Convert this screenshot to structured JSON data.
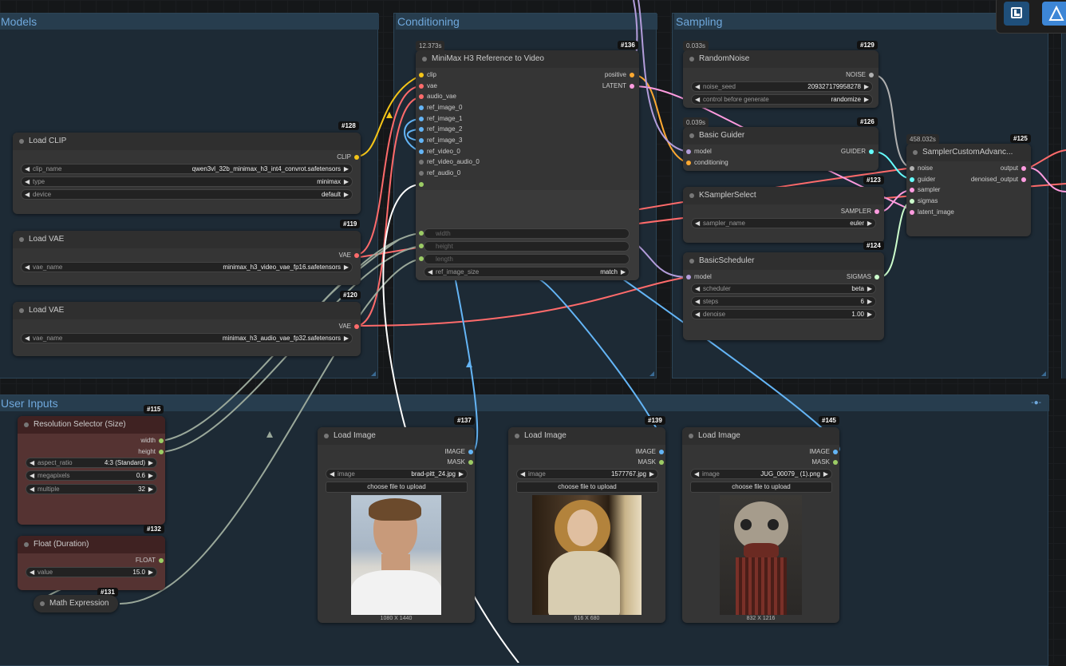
{
  "groups": {
    "models": "Models",
    "conditioning": "Conditioning",
    "sampling": "Sampling",
    "user_inputs": "User Inputs"
  },
  "nodes": {
    "load_clip": {
      "title": "Load CLIP",
      "id": "#128",
      "output": "CLIP",
      "clip_name_label": "clip_name",
      "clip_name": "qwen3vl_32b_minimax_h3_int4_convrot.safetensors",
      "type_label": "type",
      "type": "minimax",
      "device_label": "device",
      "device": "default"
    },
    "load_vae_video": {
      "title": "Load VAE",
      "id": "#119",
      "output": "VAE",
      "vae_name_label": "vae_name",
      "vae_name": "minimax_h3_video_vae_fp16.safetensors"
    },
    "load_vae_audio": {
      "title": "Load VAE",
      "id": "#120",
      "output": "VAE",
      "vae_name_label": "vae_name",
      "vae_name": "minimax_h3_audio_vae_fp32.safetensors"
    },
    "minimax": {
      "title": "MiniMax H3 Reference to Video",
      "id": "#136",
      "time": "12.373s",
      "inputs": [
        "clip",
        "vae",
        "audio_vae",
        "ref_image_0",
        "ref_image_1",
        "ref_image_2",
        "ref_image_3",
        "ref_video_0",
        "ref_video_audio_0",
        "ref_audio_0"
      ],
      "outputs": [
        "positive",
        "LATENT"
      ],
      "width_label": "width",
      "height_label": "height",
      "length_label": "length",
      "ref_image_size_label": "ref_image_size",
      "ref_image_size": "match"
    },
    "random_noise": {
      "title": "RandomNoise",
      "id": "#129",
      "time": "0.033s",
      "output": "NOISE",
      "noise_seed_label": "noise_seed",
      "noise_seed": "209327179958278",
      "control_label": "control before generate",
      "control": "randomize"
    },
    "basic_guider": {
      "title": "Basic Guider",
      "id": "#126",
      "time": "0.039s",
      "output": "GUIDER",
      "inputs": [
        "model",
        "conditioning"
      ]
    },
    "ksampler_select": {
      "title": "KSamplerSelect",
      "id": "#123",
      "output": "SAMPLER",
      "sampler_name_label": "sampler_name",
      "sampler_name": "euler"
    },
    "basic_scheduler": {
      "title": "BasicScheduler",
      "id": "#124",
      "output": "SIGMAS",
      "input": "model",
      "scheduler_label": "scheduler",
      "scheduler": "beta",
      "steps_label": "steps",
      "steps": "6",
      "denoise_label": "denoise",
      "denoise": "1.00"
    },
    "sampler_custom": {
      "title": "SamplerCustomAdvanc...",
      "id": "#125",
      "time": "458.032s",
      "inputs": [
        "noise",
        "guider",
        "sampler",
        "sigmas",
        "latent_image"
      ],
      "outputs": [
        "output",
        "denoised_output"
      ]
    },
    "resolution": {
      "title": "Resolution Selector (Size)",
      "id": "#115",
      "outputs": [
        "width",
        "height"
      ],
      "aspect_label": "aspect_ratio",
      "aspect": "4:3 (Standard)",
      "mp_label": "megapixels",
      "mp": "0.6",
      "multiple_label": "multiple",
      "multiple": "32"
    },
    "float_duration": {
      "title": "Float (Duration)",
      "id": "#132",
      "output": "FLOAT",
      "value_label": "value",
      "value": "15.0"
    },
    "math_expr": {
      "title": "Math Expression",
      "id": "#131"
    },
    "load_image_1": {
      "title": "Load Image",
      "id": "#137",
      "outputs": [
        "IMAGE",
        "MASK"
      ],
      "image_label": "image",
      "image": "brad-pitt_24.jpg",
      "upload": "choose file to upload",
      "caption": "1080 X 1440"
    },
    "load_image_2": {
      "title": "Load Image",
      "id": "#139",
      "outputs": [
        "IMAGE",
        "MASK"
      ],
      "image_label": "image",
      "image": "1577767.jpg",
      "upload": "choose file to upload",
      "caption": "616 X 680"
    },
    "load_image_3": {
      "title": "Load Image",
      "id": "#145",
      "outputs": [
        "IMAGE",
        "MASK"
      ],
      "image_label": "image",
      "image": "JUG_00079_ (1).png",
      "upload": "choose file to upload",
      "caption": "832 X 1216"
    }
  },
  "colors": {
    "clip": "#f5c518",
    "vae": "#ff6b6b",
    "image": "#64b5f6",
    "latent": "#ff9ce0",
    "int": "#9ccc65",
    "conditioning": "#ffa931",
    "model": "#b39ddb",
    "guider": "#66ffff",
    "noise": "#b0b0b0",
    "sigmas": "#cdffcd",
    "group_title": "#6fa8dc"
  },
  "toolbar_icons": [
    "layout-icon",
    "app-logo-icon"
  ]
}
